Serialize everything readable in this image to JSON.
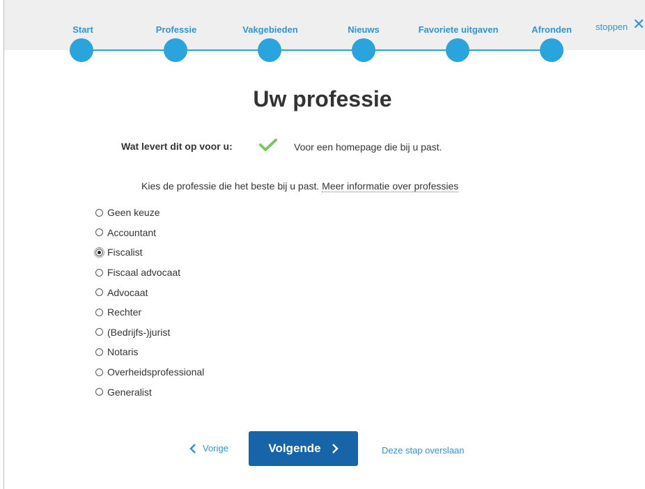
{
  "colors": {
    "accent": "#2aa4dc",
    "link": "#2f94d0",
    "primary_button": "#1764a8",
    "check": "#7cc36a"
  },
  "progress": {
    "steps": [
      {
        "label": "Start"
      },
      {
        "label": "Professie"
      },
      {
        "label": "Vakgebieden"
      },
      {
        "label": "Nieuws"
      },
      {
        "label": "Favoriete uitgaven"
      },
      {
        "label": "Afronden"
      }
    ],
    "stop_label": "stoppen",
    "stop_icon": "close-icon"
  },
  "title": "Uw professie",
  "benefit": {
    "label": "Wat levert dit op voor u:",
    "icon": "check-icon",
    "text": "Voor een homepage die bij u past."
  },
  "intro": {
    "text": "Kies de professie die het beste bij u past.",
    "link": "Meer informatie over professies"
  },
  "professions": {
    "options": [
      {
        "label": "Geen keuze"
      },
      {
        "label": "Accountant"
      },
      {
        "label": "Fiscalist"
      },
      {
        "label": "Fiscaal advocaat"
      },
      {
        "label": "Advocaat"
      },
      {
        "label": "Rechter"
      },
      {
        "label": "(Bedrijfs-)jurist"
      },
      {
        "label": "Notaris"
      },
      {
        "label": "Overheidsprofessional"
      },
      {
        "label": "Generalist"
      }
    ],
    "selected": "Fiscalist"
  },
  "nav": {
    "prev": "Vorige",
    "next": "Volgende",
    "skip": "Deze stap overslaan"
  }
}
